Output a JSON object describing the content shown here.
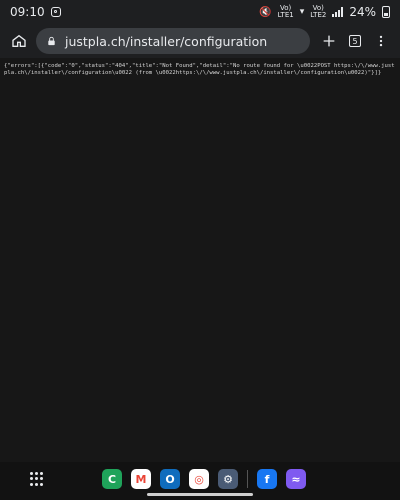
{
  "status": {
    "time": "09:10",
    "volte1_top": "Vo)",
    "volte1_bottom": "LTE1",
    "volte2_top": "Vo)",
    "volte2_bottom": "LTE2",
    "battery": "24%"
  },
  "browser": {
    "url": "justpla.ch/installer/configuration",
    "tabs": "5"
  },
  "page": {
    "body": "{\"errors\":[{\"code\":\"0\",\"status\":\"404\",\"title\":\"Not Found\",\"detail\":\"No route found for \\u0022POST https:\\/\\/www.justpla.ch\\/installer\\/configuration\\u0022 (from \\u0022https:\\/\\/www.justpla.ch\\/installer\\/configuration\\u0022)\"}]}"
  },
  "icons": {
    "home": "home-icon",
    "lock": "lock-icon",
    "add": "plus-icon",
    "menu": "more-vert-icon"
  },
  "dock": {
    "apps": [
      {
        "name": "phone-app",
        "glyph": "C",
        "color": "#1fa35a"
      },
      {
        "name": "gmail-app",
        "glyph": "M",
        "color": "#ffffff"
      },
      {
        "name": "outlook-app",
        "glyph": "O",
        "color": "#0f6cbd"
      },
      {
        "name": "chrome-app",
        "glyph": "◎",
        "color": "#ffffff"
      },
      {
        "name": "settings-app",
        "glyph": "⚙",
        "color": "#4a5b75"
      },
      {
        "name": "facebook-app",
        "glyph": "f",
        "color": "#1877f2"
      },
      {
        "name": "messenger-app",
        "glyph": "≈",
        "color": "#7f5af0"
      }
    ]
  }
}
